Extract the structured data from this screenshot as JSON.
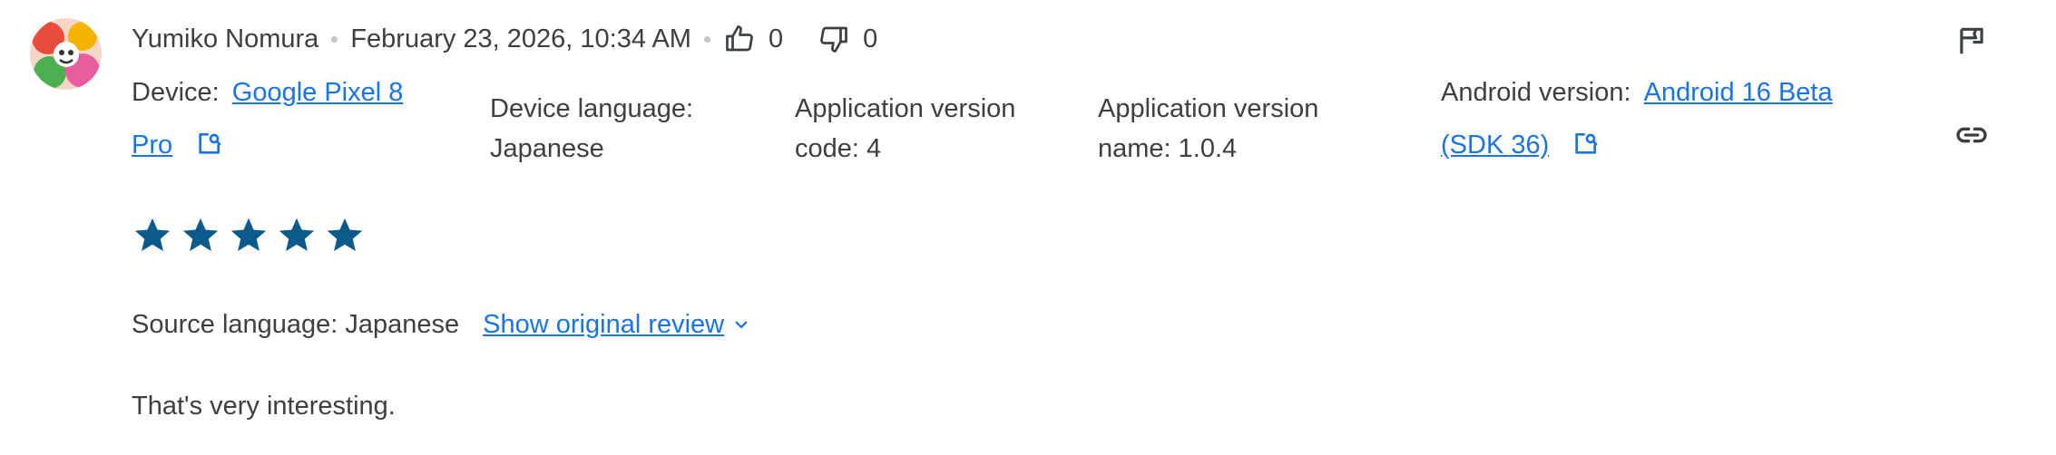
{
  "review": {
    "author": "Yumiko Nomura",
    "datetime": "February 23, 2026, 10:34 AM",
    "thumbs_up_count": "0",
    "thumbs_down_count": "0",
    "rating": 5,
    "rating_max": 5,
    "text": "That's very interesting."
  },
  "meta": {
    "device_label": "Device:",
    "device_value": "Google Pixel 8 Pro",
    "device_value_line1": "Google Pixel 8",
    "device_value_line2": "Pro",
    "device_language_label": "Device language:",
    "device_language_value": "Japanese",
    "app_version_code_label_line1": "Application version",
    "app_version_code_label_line2": "code:",
    "app_version_code_value": "4",
    "app_version_name_label_line1": "Application version",
    "app_version_name_label_line2": "name:",
    "app_version_name_value": "1.0.4",
    "android_version_label": "Android version:",
    "android_version_value_line1": "Android 16 Beta",
    "android_version_value_line2": "(SDK 36)"
  },
  "translation": {
    "source_language_label": "Source language: Japanese",
    "show_original_label": "Show original review"
  },
  "icons": {
    "thumbs_up": "thumbs-up-icon",
    "thumbs_down": "thumbs-down-icon",
    "open_external": "open-in-new-icon",
    "flag": "flag-icon",
    "link": "link-icon",
    "star": "star-icon",
    "chevron": "chevron-down-icon"
  },
  "colors": {
    "text": "#3c4043",
    "link": "#1a73e8",
    "star": "#0b5a8c",
    "separator_dot": "#c4c7c5"
  }
}
